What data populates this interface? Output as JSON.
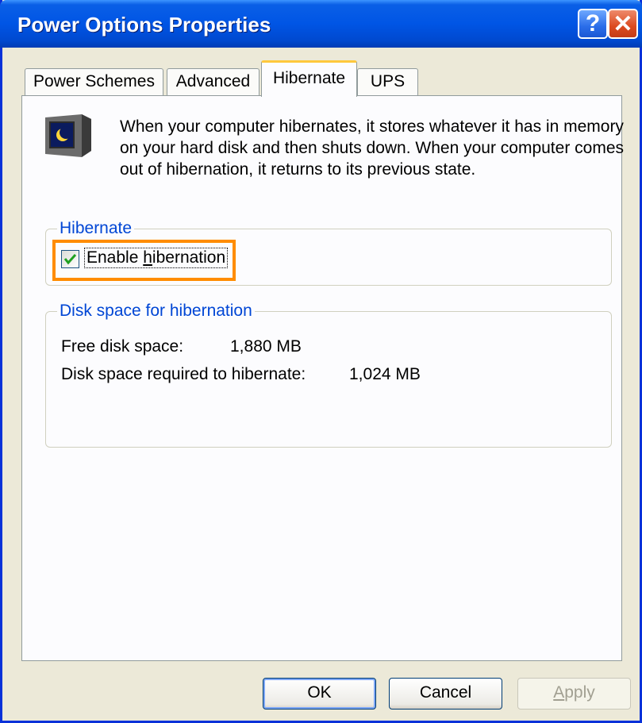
{
  "window": {
    "title": "Power Options Properties",
    "help_glyph": "?",
    "close_glyph": "✕",
    "icons": {
      "help": "help-icon",
      "close": "close-icon"
    }
  },
  "tabs": [
    {
      "label": "Power Schemes",
      "active": false
    },
    {
      "label": "Advanced",
      "active": false
    },
    {
      "label": "Hibernate",
      "active": true
    },
    {
      "label": "UPS",
      "active": false
    }
  ],
  "intro": {
    "icon": "monitor-moon-icon",
    "text": "When your computer hibernates, it stores whatever it has in memory on your hard disk and then shuts down. When your computer comes out of hibernation, it returns to its previous state."
  },
  "hibernate_group": {
    "label": "Hibernate",
    "checkbox": {
      "label_prefix": "Enable ",
      "label_accel": "h",
      "label_suffix": "ibernation",
      "checked": true
    }
  },
  "disk_group": {
    "label": "Disk space for hibernation",
    "free_label": "Free disk space:",
    "free_value": "1,880 MB",
    "required_label": "Disk space required to hibernate:",
    "required_value": "1,024 MB"
  },
  "buttons": {
    "ok": "OK",
    "cancel": "Cancel",
    "apply_accel": "A",
    "apply_rest": "pply"
  },
  "colors": {
    "titlebar": "#0055e5",
    "group_label": "#0046d5",
    "highlight": "#ff8c00",
    "active_tab_accent": "#ffc83c"
  }
}
